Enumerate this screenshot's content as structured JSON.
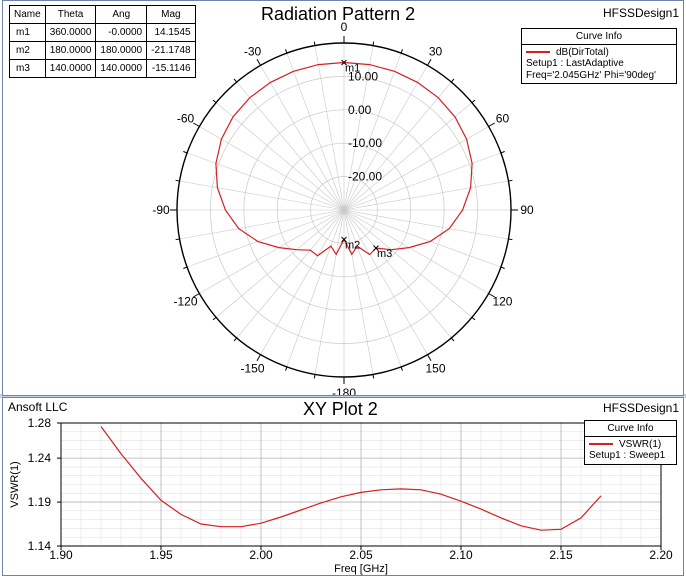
{
  "top_panel": {
    "title": "Radiation Pattern 2",
    "design_name": "HFSSDesign1",
    "marker_table": {
      "headers": [
        "Name",
        "Theta",
        "Ang",
        "Mag"
      ],
      "rows": [
        [
          "m1",
          "360.0000",
          "-0.0000",
          "14.1545"
        ],
        [
          "m2",
          "180.0000",
          "180.0000",
          "-21.1748"
        ],
        [
          "m3",
          "140.0000",
          "140.0000",
          "-15.1146"
        ]
      ]
    },
    "legend": {
      "header": "Curve Info",
      "series_label": "dB(DirTotal)",
      "line1": "Setup1 : LastAdaptive",
      "line2": "Freq='2.045GHz' Phi='90deg'"
    },
    "markers": [
      "m1",
      "m2",
      "m3"
    ]
  },
  "bottom_panel": {
    "title": "XY Plot 2",
    "company": "Ansoft LLC",
    "design_name": "HFSSDesign1",
    "legend": {
      "header": "Curve Info",
      "series_label": "VSWR(1)",
      "line1": "Setup1 : Sweep1"
    }
  },
  "colors": {
    "curve": "#d42020",
    "grid": "#c8c8c8",
    "panel_border": "#6e84a8"
  },
  "chart_data": [
    {
      "type": "polar",
      "title": "Radiation Pattern 2",
      "angle_labels": [
        "0",
        "30",
        "60",
        "90",
        "120",
        "150",
        "-180",
        "-150",
        "-120",
        "-90",
        "-60",
        "-30"
      ],
      "angle_values": [
        0,
        30,
        60,
        90,
        120,
        150,
        180,
        210,
        240,
        270,
        300,
        330
      ],
      "radial_labels": [
        "10.00",
        "0.00",
        "-10.00",
        "-20.00"
      ],
      "radial_values": [
        10,
        0,
        -10,
        -20
      ],
      "rlim": [
        -30,
        20
      ],
      "series": [
        {
          "name": "dB(DirTotal)",
          "theta": [
            -180,
            -170,
            -160,
            -150,
            -140,
            -130,
            -120,
            -110,
            -100,
            -90,
            -80,
            -70,
            -60,
            -50,
            -40,
            -30,
            -20,
            -10,
            0,
            10,
            20,
            30,
            40,
            50,
            60,
            70,
            80,
            90,
            100,
            110,
            120,
            130,
            140,
            150,
            160,
            170,
            180
          ],
          "values": [
            -21.2,
            -16.5,
            -18.5,
            -14.2,
            -14.3,
            -11.5,
            -7.5,
            -2.5,
            2.0,
            5.5,
            8.5,
            10.8,
            12.4,
            13.4,
            13.9,
            14.1,
            14.2,
            14.2,
            14.15,
            14.2,
            14.2,
            14.1,
            13.9,
            13.4,
            12.4,
            10.8,
            8.5,
            5.5,
            2.0,
            -2.5,
            -7.5,
            -11.5,
            -15.1,
            -14.6,
            -18.5,
            -16.5,
            -21.2
          ]
        }
      ],
      "markers": [
        {
          "name": "m1",
          "theta": 360,
          "value": 14.1545
        },
        {
          "name": "m2",
          "theta": 180,
          "value": -21.1748
        },
        {
          "name": "m3",
          "theta": 140,
          "value": -15.1146
        }
      ]
    },
    {
      "type": "line",
      "title": "XY Plot 2",
      "xlabel": "Freq [GHz]",
      "ylabel": "VSWR(1)",
      "xlim": [
        1.9,
        2.2
      ],
      "ylim": [
        1.14,
        1.28
      ],
      "xticks": [
        1.9,
        1.95,
        2.0,
        2.05,
        2.1,
        2.15,
        2.2
      ],
      "xtick_labels": [
        "1.90",
        "1.95",
        "2.00",
        "2.05",
        "2.10",
        "2.15",
        "2.20"
      ],
      "yticks": [
        1.14,
        1.19,
        1.24,
        1.28
      ],
      "ytick_labels": [
        "1.14",
        "1.19",
        "1.24",
        "1.28"
      ],
      "grid": true,
      "series": [
        {
          "name": "VSWR(1)",
          "x": [
            1.92,
            1.93,
            1.94,
            1.95,
            1.96,
            1.97,
            1.98,
            1.99,
            2.0,
            2.01,
            2.02,
            2.03,
            2.04,
            2.05,
            2.06,
            2.07,
            2.08,
            2.09,
            2.1,
            2.11,
            2.12,
            2.13,
            2.14,
            2.15,
            2.16,
            2.17
          ],
          "y": [
            1.276,
            1.245,
            1.217,
            1.192,
            1.176,
            1.165,
            1.162,
            1.162,
            1.166,
            1.173,
            1.181,
            1.189,
            1.196,
            1.201,
            1.204,
            1.205,
            1.204,
            1.199,
            1.191,
            1.182,
            1.172,
            1.163,
            1.158,
            1.159,
            1.172,
            1.197
          ]
        }
      ]
    }
  ]
}
